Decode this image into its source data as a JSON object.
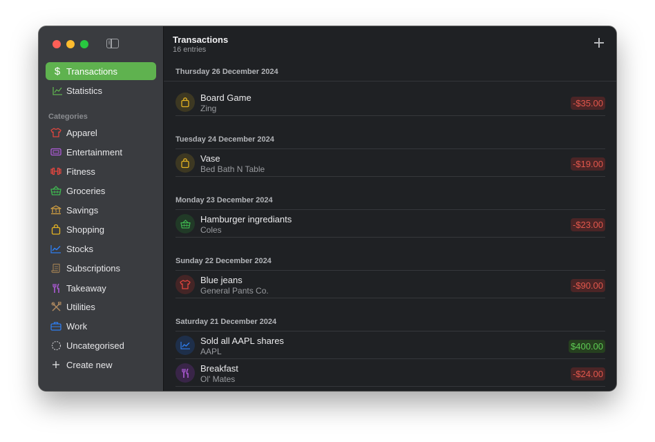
{
  "sidebar": {
    "nav": [
      {
        "label": "Transactions",
        "icon": "dollar-icon",
        "active": true
      },
      {
        "label": "Statistics",
        "icon": "chart-icon",
        "active": false
      }
    ],
    "section_title": "Categories",
    "categories": [
      {
        "label": "Apparel",
        "icon": "tshirt-icon",
        "color": "#e2463f"
      },
      {
        "label": "Entertainment",
        "icon": "ticket-icon",
        "color": "#b05bd9"
      },
      {
        "label": "Fitness",
        "icon": "dumbbell-icon",
        "color": "#e2463f"
      },
      {
        "label": "Groceries",
        "icon": "basket-icon",
        "color": "#3fb950"
      },
      {
        "label": "Savings",
        "icon": "bank-icon",
        "color": "#d9a441"
      },
      {
        "label": "Shopping",
        "icon": "bag-icon",
        "color": "#e6b422"
      },
      {
        "label": "Stocks",
        "icon": "stocks-chart-icon",
        "color": "#2f7ef0"
      },
      {
        "label": "Subscriptions",
        "icon": "scroll-icon",
        "color": "#9b7c52"
      },
      {
        "label": "Takeaway",
        "icon": "fork-knife-icon",
        "color": "#b05bd9"
      },
      {
        "label": "Utilities",
        "icon": "tools-icon",
        "color": "#b08a60"
      },
      {
        "label": "Work",
        "icon": "briefcase-icon",
        "color": "#2f7ef0"
      },
      {
        "label": "Uncategorised",
        "icon": "dashed-circle-icon",
        "color": "#c8c8cc"
      },
      {
        "label": "Create new",
        "icon": "plus-icon",
        "color": "#e8e8ea"
      }
    ]
  },
  "main": {
    "title": "Transactions",
    "subtitle": "16 entries",
    "groups": [
      {
        "date": "Thursday 26 December 2024",
        "rows": [
          {
            "name": "Board Game",
            "merchant": "Zing",
            "amount": "-$35.00",
            "positive": false,
            "icon": "bag-icon",
            "color": "#e6b422"
          }
        ]
      },
      {
        "date": "Tuesday 24 December 2024",
        "rows": [
          {
            "name": "Vase",
            "merchant": "Bed Bath N Table",
            "amount": "-$19.00",
            "positive": false,
            "icon": "bag-icon",
            "color": "#e6b422"
          }
        ]
      },
      {
        "date": "Monday 23 December 2024",
        "rows": [
          {
            "name": "Hamburger ingrediants",
            "merchant": "Coles",
            "amount": "-$23.00",
            "positive": false,
            "icon": "basket-icon",
            "color": "#3fb950"
          }
        ]
      },
      {
        "date": "Sunday 22 December 2024",
        "rows": [
          {
            "name": "Blue jeans",
            "merchant": "General Pants Co.",
            "amount": "-$90.00",
            "positive": false,
            "icon": "tshirt-icon",
            "color": "#e2463f"
          }
        ]
      },
      {
        "date": "Saturday 21 December 2024",
        "rows": [
          {
            "name": "Sold all AAPL shares",
            "merchant": "AAPL",
            "amount": "$400.00",
            "positive": true,
            "icon": "stocks-chart-icon",
            "color": "#2f7ef0"
          },
          {
            "name": "Breakfast",
            "merchant": "Ol' Mates",
            "amount": "-$24.00",
            "positive": false,
            "icon": "fork-knife-icon",
            "color": "#b05bd9"
          }
        ]
      }
    ]
  },
  "colors": {
    "accent": "#5fb24f",
    "negative": "#e2574c",
    "positive": "#5ecb54"
  }
}
